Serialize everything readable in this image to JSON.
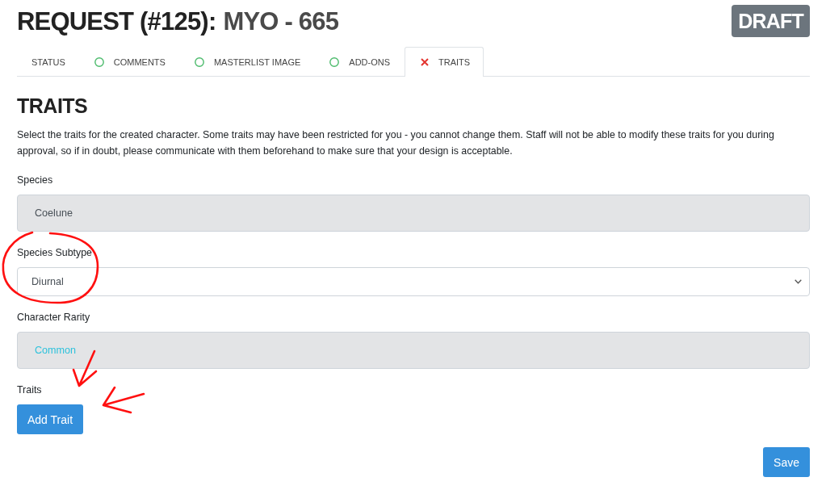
{
  "header": {
    "title": "REQUEST (#125):",
    "subtitle": "MYO - 665",
    "badge": "DRAFT"
  },
  "tabs": [
    {
      "label": "STATUS",
      "kind": "plain",
      "selected": false
    },
    {
      "label": "COMMENTS",
      "kind": "done",
      "selected": false
    },
    {
      "label": "MASTERLIST IMAGE",
      "kind": "done",
      "selected": false
    },
    {
      "label": "ADD-ONS",
      "kind": "done",
      "selected": false
    },
    {
      "label": "TRAITS",
      "kind": "missing",
      "selected": true
    }
  ],
  "section": {
    "heading": "TRAITS",
    "description": "Select the traits for the created character. Some traits may have been restricted for you - you cannot change them. Staff will not be able to modify these traits for you during approval, so if in doubt, please communicate with them beforehand to make sure that your design is acceptable."
  },
  "fields": [
    {
      "label": "Species",
      "kind": "static",
      "value": "Coelune"
    },
    {
      "label": "Species Subtype",
      "kind": "select",
      "value": "Diurnal"
    },
    {
      "label": "Character Rarity",
      "kind": "static",
      "value": "Common",
      "color": "#2dc2dc"
    }
  ],
  "traits": {
    "label": "Traits",
    "button": "Add Trait"
  },
  "save_button": "Save",
  "annotations": [
    {
      "kind": "circle"
    },
    {
      "kind": "arrow"
    },
    {
      "kind": "arrow"
    }
  ]
}
